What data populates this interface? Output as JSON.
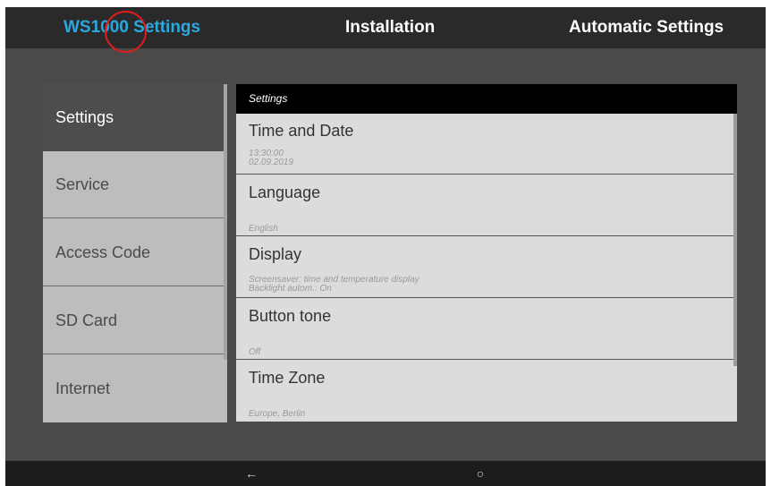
{
  "topbar": {
    "tabs": [
      {
        "label": "WS1000 Settings"
      },
      {
        "label": "Installation"
      },
      {
        "label": "Automatic Settings"
      }
    ],
    "active_color": "#29a9e0"
  },
  "sidebar": {
    "items": [
      {
        "label": "Settings"
      },
      {
        "label": "Service"
      },
      {
        "label": "Access Code"
      },
      {
        "label": "SD Card"
      },
      {
        "label": "Internet"
      }
    ],
    "selected": "Settings"
  },
  "panel": {
    "header": "Settings",
    "items": [
      {
        "title": "Time and Date",
        "lines": [
          "13:30:00",
          "02.09.2019"
        ]
      },
      {
        "title": "Language",
        "lines": [
          "English"
        ]
      },
      {
        "title": "Display",
        "lines": [
          "Screensaver: time and temperature display",
          "Backlight autom.: On"
        ]
      },
      {
        "title": "Button tone",
        "lines": [
          "Off"
        ]
      },
      {
        "title": "Time Zone",
        "lines": [
          "Europe, Berlin"
        ]
      }
    ]
  },
  "navbar": {
    "back_glyph": "←",
    "home_glyph": "○"
  }
}
